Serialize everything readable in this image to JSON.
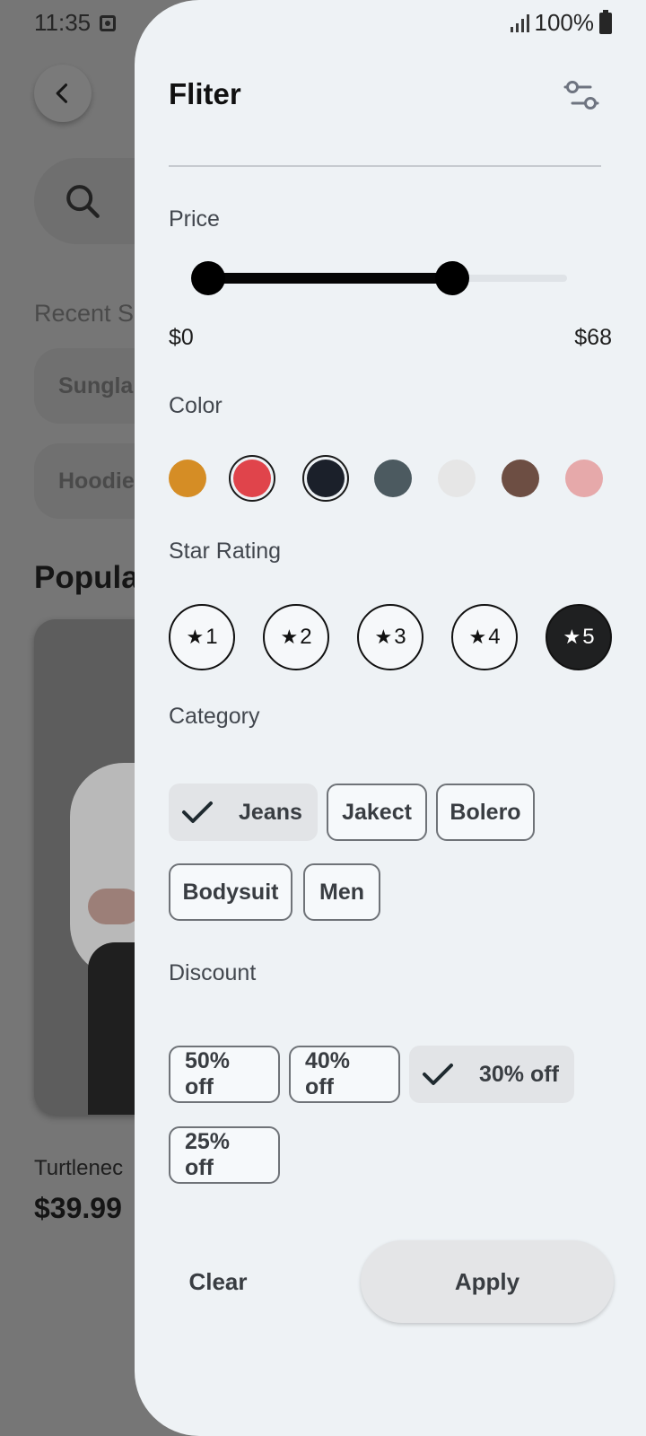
{
  "status_bar": {
    "time": "11:35",
    "battery": "100%"
  },
  "background": {
    "recent_title": "Recent S",
    "recent_chips": [
      "Sungla",
      "Hoodie"
    ],
    "popular_title": "Popula",
    "product": {
      "name": "Turtlenec",
      "price": "$39.99"
    }
  },
  "filter": {
    "title": "Fliter",
    "price": {
      "label": "Price",
      "min_label": "$0",
      "max_label": "$68",
      "range_fraction": [
        0.0,
        0.68
      ]
    },
    "color": {
      "label": "Color",
      "swatches": [
        {
          "hex": "#D58D25",
          "selected": false
        },
        {
          "hex": "#E0444B",
          "selected": true
        },
        {
          "hex": "#1B202A",
          "selected": true
        },
        {
          "hex": "#4C5A60",
          "selected": false
        },
        {
          "hex": "#E6E6E6",
          "selected": false
        },
        {
          "hex": "#6D4E43",
          "selected": false
        },
        {
          "hex": "#E6A9AA",
          "selected": false
        }
      ]
    },
    "star_rating": {
      "label": "Star Rating",
      "options": [
        "1",
        "2",
        "3",
        "4",
        "5"
      ],
      "selected": "5"
    },
    "category": {
      "label": "Category",
      "chips": [
        {
          "label": "Jeans",
          "selected": true
        },
        {
          "label": "Jakect",
          "selected": false
        },
        {
          "label": "Bolero",
          "selected": false
        },
        {
          "label": "Bodysuit",
          "selected": false
        },
        {
          "label": "Men",
          "selected": false
        }
      ]
    },
    "discount": {
      "label": "Discount",
      "chips": [
        {
          "label": "50% off",
          "selected": false
        },
        {
          "label": "40% off",
          "selected": false
        },
        {
          "label": "30% off",
          "selected": true
        },
        {
          "label": "25% off",
          "selected": false
        }
      ]
    },
    "clear_label": "Clear",
    "apply_label": "Apply"
  }
}
